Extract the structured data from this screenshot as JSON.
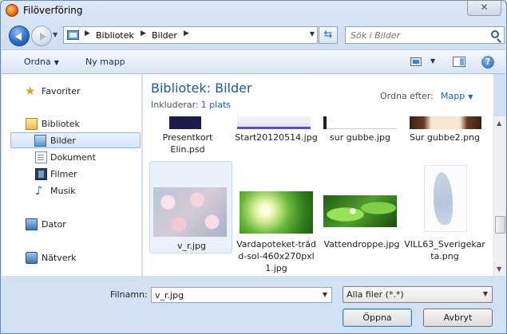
{
  "window": {
    "title": "Filöverföring"
  },
  "address": {
    "crumbs": [
      "Bibliotek",
      "Bilder"
    ]
  },
  "search": {
    "placeholder": "Sök i Bilder"
  },
  "toolbar": {
    "organize": "Ordna",
    "new_folder": "Ny mapp"
  },
  "nav": {
    "favorites": "Favoriter",
    "libraries": "Bibliotek",
    "pictures": "Bilder",
    "documents": "Dokument",
    "videos": "Filmer",
    "music": "Musik",
    "computer": "Dator",
    "network": "Nätverk"
  },
  "library": {
    "title": "Bibliotek: Bilder",
    "includes_label": "Inkluderar:",
    "includes_link": "1 plats",
    "arrange_label": "Ordna efter:",
    "arrange_value": "Mapp"
  },
  "files_row1": [
    {
      "name_line1": "Presentkort",
      "name_line2": "Elin.psd"
    },
    {
      "name_line1": "Start20120514.jpg",
      "name_line2": ""
    },
    {
      "name_line1": "sur gubbe.jpg",
      "name_line2": ""
    },
    {
      "name_line1": "Sur gubbe2.png",
      "name_line2": ""
    }
  ],
  "files_row2": [
    {
      "line1": "v_r.jpg",
      "line2": "",
      "line3": ""
    },
    {
      "line1": "Vardapoteket-träd",
      "line2": "d-sol-460x270pxl",
      "line3": "1.jpg"
    },
    {
      "line1": "Vattendroppe.jpg",
      "line2": "",
      "line3": ""
    },
    {
      "line1": "VILL63_Sverigekar",
      "line2": "ta.png",
      "line3": ""
    }
  ],
  "bottom": {
    "filename_label": "Filnamn:",
    "filename_value": "v_r.jpg",
    "filter": "Alla filer (*.*)",
    "open": "Öppna",
    "cancel": "Avbryt"
  },
  "icons": [
    "firefox-icon",
    "back-icon",
    "forward-icon",
    "folder-icon",
    "refresh-icon",
    "search-icon",
    "views-icon",
    "preview-pane-icon",
    "help-icon",
    "star-icon",
    "library-icon",
    "pictures-icon",
    "documents-icon",
    "videos-icon",
    "music-icon",
    "computer-icon",
    "network-icon"
  ]
}
